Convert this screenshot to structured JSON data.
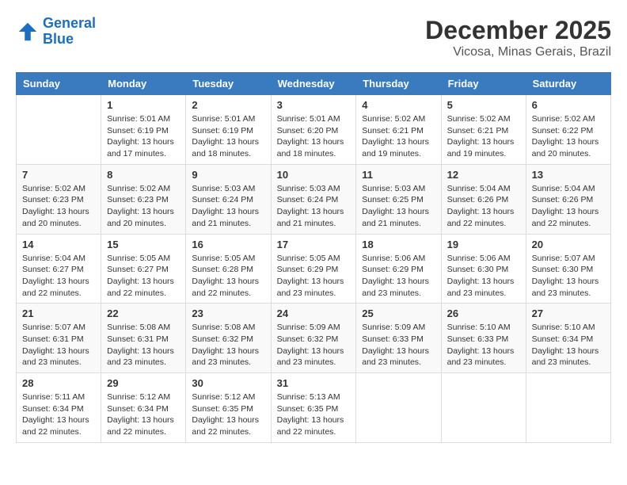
{
  "logo": {
    "line1": "General",
    "line2": "Blue"
  },
  "title": "December 2025",
  "subtitle": "Vicosa, Minas Gerais, Brazil",
  "days_of_week": [
    "Sunday",
    "Monday",
    "Tuesday",
    "Wednesday",
    "Thursday",
    "Friday",
    "Saturday"
  ],
  "weeks": [
    [
      {
        "day": "",
        "sunrise": "",
        "sunset": "",
        "daylight": ""
      },
      {
        "day": "1",
        "sunrise": "Sunrise: 5:01 AM",
        "sunset": "Sunset: 6:19 PM",
        "daylight": "Daylight: 13 hours and 17 minutes."
      },
      {
        "day": "2",
        "sunrise": "Sunrise: 5:01 AM",
        "sunset": "Sunset: 6:19 PM",
        "daylight": "Daylight: 13 hours and 18 minutes."
      },
      {
        "day": "3",
        "sunrise": "Sunrise: 5:01 AM",
        "sunset": "Sunset: 6:20 PM",
        "daylight": "Daylight: 13 hours and 18 minutes."
      },
      {
        "day": "4",
        "sunrise": "Sunrise: 5:02 AM",
        "sunset": "Sunset: 6:21 PM",
        "daylight": "Daylight: 13 hours and 19 minutes."
      },
      {
        "day": "5",
        "sunrise": "Sunrise: 5:02 AM",
        "sunset": "Sunset: 6:21 PM",
        "daylight": "Daylight: 13 hours and 19 minutes."
      },
      {
        "day": "6",
        "sunrise": "Sunrise: 5:02 AM",
        "sunset": "Sunset: 6:22 PM",
        "daylight": "Daylight: 13 hours and 20 minutes."
      }
    ],
    [
      {
        "day": "7",
        "sunrise": "Sunrise: 5:02 AM",
        "sunset": "Sunset: 6:23 PM",
        "daylight": "Daylight: 13 hours and 20 minutes."
      },
      {
        "day": "8",
        "sunrise": "Sunrise: 5:02 AM",
        "sunset": "Sunset: 6:23 PM",
        "daylight": "Daylight: 13 hours and 20 minutes."
      },
      {
        "day": "9",
        "sunrise": "Sunrise: 5:03 AM",
        "sunset": "Sunset: 6:24 PM",
        "daylight": "Daylight: 13 hours and 21 minutes."
      },
      {
        "day": "10",
        "sunrise": "Sunrise: 5:03 AM",
        "sunset": "Sunset: 6:24 PM",
        "daylight": "Daylight: 13 hours and 21 minutes."
      },
      {
        "day": "11",
        "sunrise": "Sunrise: 5:03 AM",
        "sunset": "Sunset: 6:25 PM",
        "daylight": "Daylight: 13 hours and 21 minutes."
      },
      {
        "day": "12",
        "sunrise": "Sunrise: 5:04 AM",
        "sunset": "Sunset: 6:26 PM",
        "daylight": "Daylight: 13 hours and 22 minutes."
      },
      {
        "day": "13",
        "sunrise": "Sunrise: 5:04 AM",
        "sunset": "Sunset: 6:26 PM",
        "daylight": "Daylight: 13 hours and 22 minutes."
      }
    ],
    [
      {
        "day": "14",
        "sunrise": "Sunrise: 5:04 AM",
        "sunset": "Sunset: 6:27 PM",
        "daylight": "Daylight: 13 hours and 22 minutes."
      },
      {
        "day": "15",
        "sunrise": "Sunrise: 5:05 AM",
        "sunset": "Sunset: 6:27 PM",
        "daylight": "Daylight: 13 hours and 22 minutes."
      },
      {
        "day": "16",
        "sunrise": "Sunrise: 5:05 AM",
        "sunset": "Sunset: 6:28 PM",
        "daylight": "Daylight: 13 hours and 22 minutes."
      },
      {
        "day": "17",
        "sunrise": "Sunrise: 5:05 AM",
        "sunset": "Sunset: 6:29 PM",
        "daylight": "Daylight: 13 hours and 23 minutes."
      },
      {
        "day": "18",
        "sunrise": "Sunrise: 5:06 AM",
        "sunset": "Sunset: 6:29 PM",
        "daylight": "Daylight: 13 hours and 23 minutes."
      },
      {
        "day": "19",
        "sunrise": "Sunrise: 5:06 AM",
        "sunset": "Sunset: 6:30 PM",
        "daylight": "Daylight: 13 hours and 23 minutes."
      },
      {
        "day": "20",
        "sunrise": "Sunrise: 5:07 AM",
        "sunset": "Sunset: 6:30 PM",
        "daylight": "Daylight: 13 hours and 23 minutes."
      }
    ],
    [
      {
        "day": "21",
        "sunrise": "Sunrise: 5:07 AM",
        "sunset": "Sunset: 6:31 PM",
        "daylight": "Daylight: 13 hours and 23 minutes."
      },
      {
        "day": "22",
        "sunrise": "Sunrise: 5:08 AM",
        "sunset": "Sunset: 6:31 PM",
        "daylight": "Daylight: 13 hours and 23 minutes."
      },
      {
        "day": "23",
        "sunrise": "Sunrise: 5:08 AM",
        "sunset": "Sunset: 6:32 PM",
        "daylight": "Daylight: 13 hours and 23 minutes."
      },
      {
        "day": "24",
        "sunrise": "Sunrise: 5:09 AM",
        "sunset": "Sunset: 6:32 PM",
        "daylight": "Daylight: 13 hours and 23 minutes."
      },
      {
        "day": "25",
        "sunrise": "Sunrise: 5:09 AM",
        "sunset": "Sunset: 6:33 PM",
        "daylight": "Daylight: 13 hours and 23 minutes."
      },
      {
        "day": "26",
        "sunrise": "Sunrise: 5:10 AM",
        "sunset": "Sunset: 6:33 PM",
        "daylight": "Daylight: 13 hours and 23 minutes."
      },
      {
        "day": "27",
        "sunrise": "Sunrise: 5:10 AM",
        "sunset": "Sunset: 6:34 PM",
        "daylight": "Daylight: 13 hours and 23 minutes."
      }
    ],
    [
      {
        "day": "28",
        "sunrise": "Sunrise: 5:11 AM",
        "sunset": "Sunset: 6:34 PM",
        "daylight": "Daylight: 13 hours and 22 minutes."
      },
      {
        "day": "29",
        "sunrise": "Sunrise: 5:12 AM",
        "sunset": "Sunset: 6:34 PM",
        "daylight": "Daylight: 13 hours and 22 minutes."
      },
      {
        "day": "30",
        "sunrise": "Sunrise: 5:12 AM",
        "sunset": "Sunset: 6:35 PM",
        "daylight": "Daylight: 13 hours and 22 minutes."
      },
      {
        "day": "31",
        "sunrise": "Sunrise: 5:13 AM",
        "sunset": "Sunset: 6:35 PM",
        "daylight": "Daylight: 13 hours and 22 minutes."
      },
      {
        "day": "",
        "sunrise": "",
        "sunset": "",
        "daylight": ""
      },
      {
        "day": "",
        "sunrise": "",
        "sunset": "",
        "daylight": ""
      },
      {
        "day": "",
        "sunrise": "",
        "sunset": "",
        "daylight": ""
      }
    ]
  ]
}
